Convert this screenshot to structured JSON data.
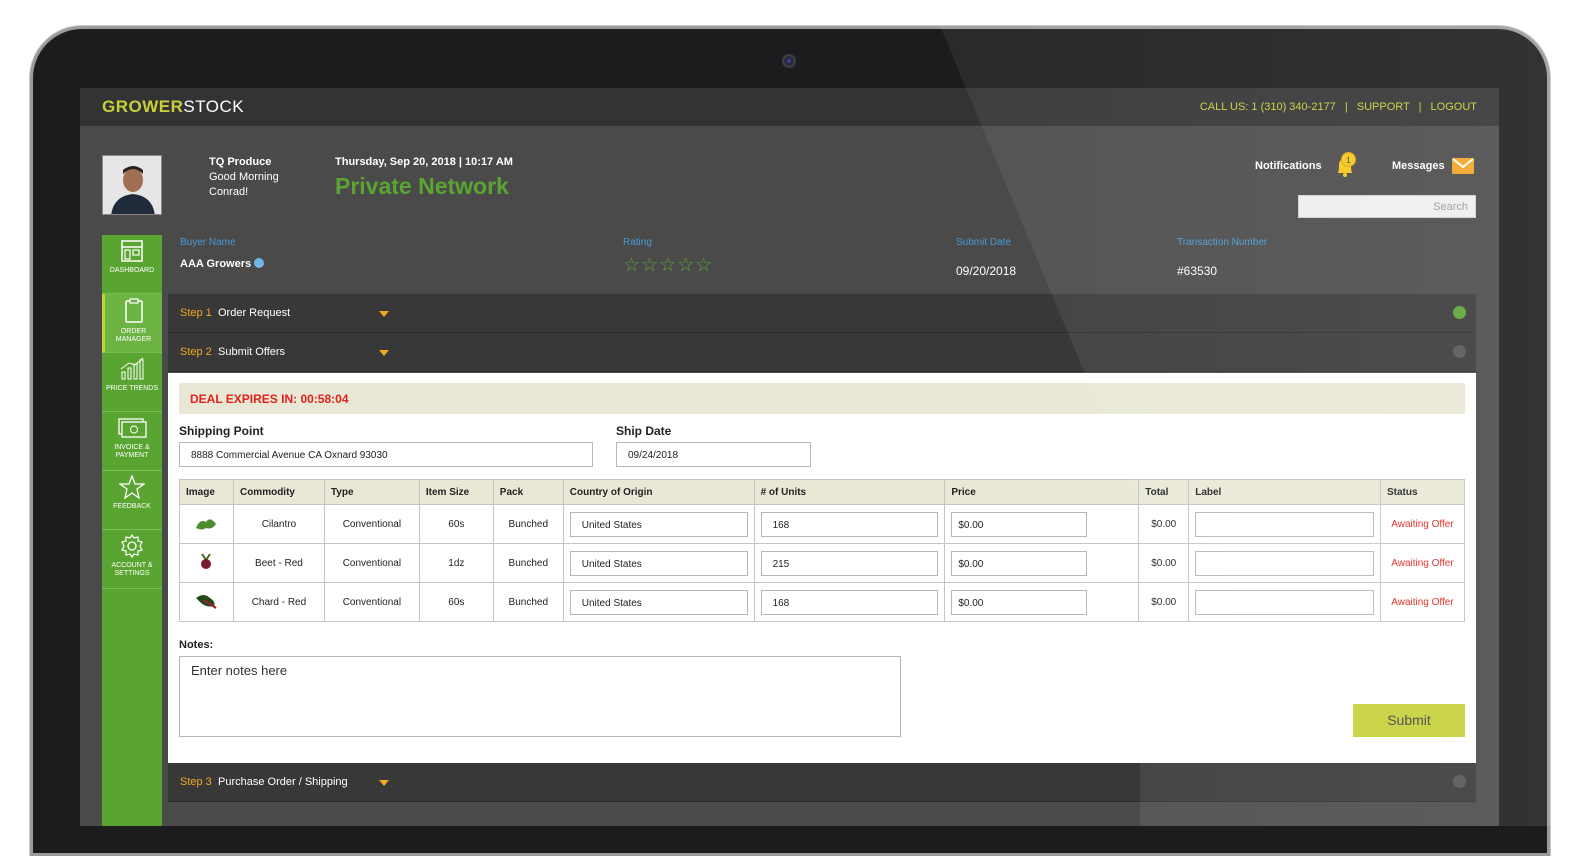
{
  "header": {
    "logo_bold": "GROWER",
    "logo_light": "STOCK",
    "call_us": "CALL US: 1 (310) 340-2177",
    "separator": "|",
    "support": "SUPPORT",
    "logout": "LOGOUT"
  },
  "user": {
    "company": "TQ Produce",
    "greeting_line1": "Good Morning",
    "greeting_line2": "Conrad!",
    "datetime": "Thursday, Sep 20, 2018 | 10:17 AM",
    "network": "Private Network"
  },
  "alerts": {
    "notifications_label": "Notifications",
    "notifications_count": "1",
    "messages_label": "Messages",
    "search_placeholder": "Search"
  },
  "sidebar": {
    "items": [
      {
        "label": "DASHBOARD",
        "icon": "dashboard-icon"
      },
      {
        "label": "ORDER MANAGER",
        "icon": "clipboard-icon"
      },
      {
        "label": "PRICE TRENDS",
        "icon": "chart-icon"
      },
      {
        "label": "INVOICE & PAYMENT",
        "icon": "money-icon"
      },
      {
        "label": "FEEDBACK",
        "icon": "star-icon"
      },
      {
        "label": "ACCOUNT & SETTINGS",
        "icon": "gear-icon"
      }
    ],
    "active": "ORDER MANAGER"
  },
  "order_info": {
    "buyer_label": "Buyer Name",
    "buyer_value": "AAA Growers",
    "rating_label": "Rating",
    "rating_stars": "☆☆☆☆☆",
    "submit_date_label": "Submit Date",
    "submit_date_value": "09/20/2018",
    "transaction_label": "Transaction Number",
    "transaction_value": "#63530"
  },
  "steps": [
    {
      "num": "Step 1",
      "title": "Order Request",
      "status": "complete"
    },
    {
      "num": "Step 2",
      "title": "Submit Offers",
      "status": "open"
    },
    {
      "num": "Step 3",
      "title": "Purchase Order / Shipping",
      "status": "pending"
    }
  ],
  "offer": {
    "deal_expires": "DEAL EXPIRES IN:  00:58:04",
    "shipping_point_label": "Shipping Point",
    "shipping_point_value": "8888 Commercial Avenue CA Oxnard 93030",
    "ship_date_label": "Ship Date",
    "ship_date_value": "09/24/2018",
    "columns": [
      "Image",
      "Commodity",
      "Type",
      "Item Size",
      "Pack",
      "Country of Origin",
      "# of Units",
      "Price",
      "Total",
      "Label",
      "Status"
    ],
    "rows": [
      {
        "commodity": "Cilantro",
        "type": "Conventional",
        "size": "60s",
        "pack": "Bunched",
        "origin": "United States",
        "units": "168",
        "price": "$0.00",
        "total": "$0.00",
        "label": "",
        "status": "Awaiting Offer"
      },
      {
        "commodity": "Beet - Red",
        "type": "Conventional",
        "size": "1dz",
        "pack": "Bunched",
        "origin": "United States",
        "units": "215",
        "price": "$0.00",
        "total": "$0.00",
        "label": "",
        "status": "Awaiting Offer"
      },
      {
        "commodity": "Chard - Red",
        "type": "Conventional",
        "size": "60s",
        "pack": "Bunched",
        "origin": "United States",
        "units": "168",
        "price": "$0.00",
        "total": "$0.00",
        "label": "",
        "status": "Awaiting Offer"
      }
    ],
    "notes_label": "Notes:",
    "notes_placeholder": "Enter notes here",
    "submit_label": "Submit"
  },
  "colors": {
    "brand_green": "#5aa532",
    "lime": "#c6d13a",
    "orange": "#f2a624",
    "alert_red": "#e0221b",
    "link_blue": "#4a9ad6"
  }
}
